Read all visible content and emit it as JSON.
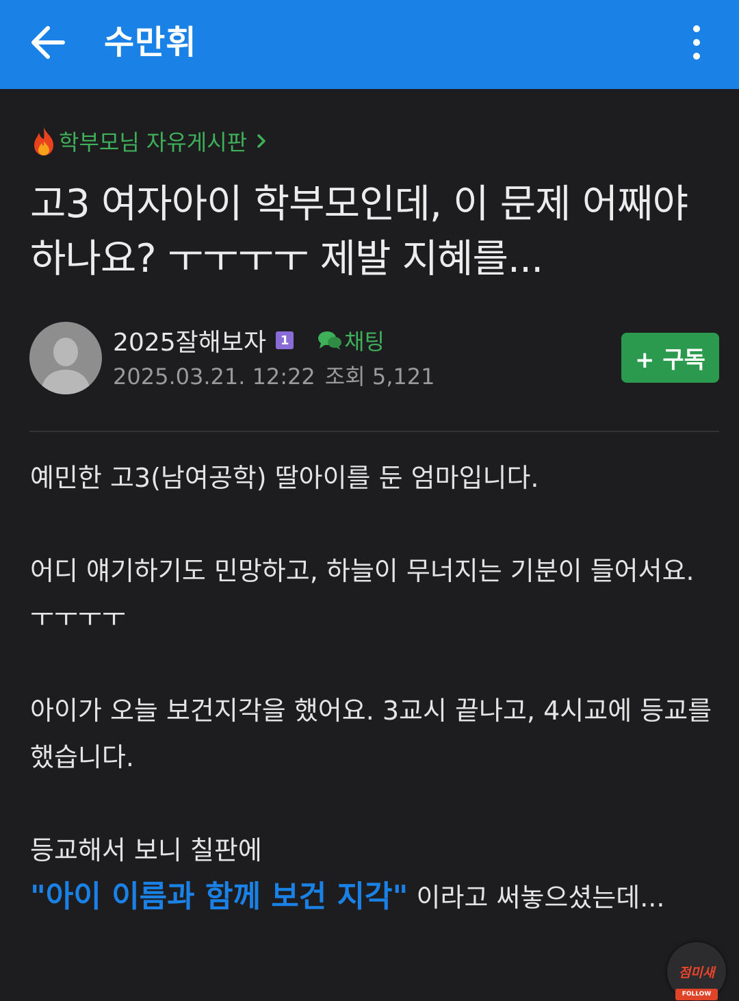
{
  "topbar": {
    "title": "수만휘",
    "back_icon": "arrow-left-icon",
    "more_icon": "vertical-dots-icon",
    "color": "#1a82e7"
  },
  "post": {
    "board": "학부모님 자유게시판",
    "board_icon": "fire-icon",
    "title": "고3 여자아이 학부모인데, 이 문제 어째야 하나요? ㅜㅜㅜㅜ 제발 지혜를...",
    "author": "2025잘해보자",
    "level_badge": "1",
    "chat_label": "채팅",
    "date": "2025.03.21. 12:22",
    "views_label": "조회 5,121",
    "subscribe_label": "+ 구독",
    "body": {
      "p1": "예민한 고3(남여공학) 딸아이를 둔 엄마입니다.",
      "p2_line1": "어디 얘기하기도 민망하고, 하늘이 무너지는 기분이 들어서요.",
      "p2_line2": "ㅜㅜㅜㅜ",
      "p3": "아이가 오늘 보건지각을 했어요. 3교시 끝나고, 4시교에 등교를 했습니다.",
      "p4_line1": "등교해서 보니 칠판에",
      "p4_highlight": "\"아이 이름과 함께 보건 지각\"",
      "p4_rest": " 이라고 써놓으셨는데..."
    }
  },
  "floating": {
    "logo_text": "점미새",
    "follow_label": "FOLLOW"
  },
  "colors": {
    "accent_green": "#3fb05a",
    "subscribe_green": "#2b9a4f",
    "highlight_blue": "#1a82e7",
    "background": "#1d1d1f"
  }
}
